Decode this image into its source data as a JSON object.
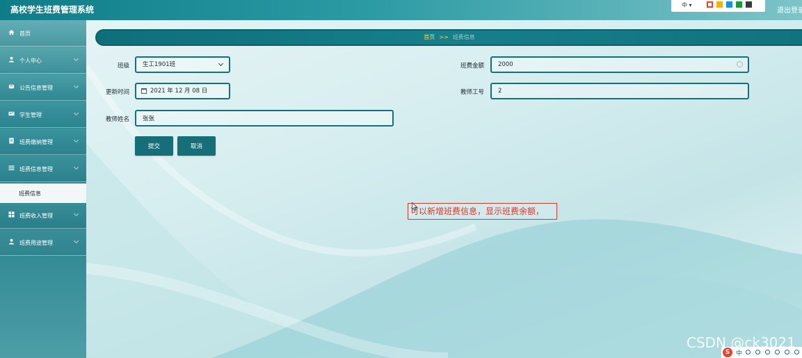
{
  "app": {
    "title": "高校学生班费管理系统",
    "logout_label": "退出登录"
  },
  "toolbox": {
    "ime_select": "中 ▾",
    "swatches": [
      "#e8412c",
      "#f2b21a",
      "#1b8fe0",
      "#1a9b3a",
      "#3a3a3a"
    ]
  },
  "sidebar": {
    "items": [
      {
        "label": "首页",
        "icon": "home-icon"
      },
      {
        "label": "个人中心",
        "icon": "user-icon"
      },
      {
        "label": "公告信息管理",
        "icon": "notice-icon"
      },
      {
        "label": "学生管理",
        "icon": "student-icon"
      },
      {
        "label": "班费缴纳管理",
        "icon": "payment-icon"
      },
      {
        "label": "班费信息管理",
        "icon": "list-icon"
      },
      {
        "label": "班费收入管理",
        "icon": "grid-icon"
      },
      {
        "label": "班费用途管理",
        "icon": "user-icon"
      }
    ],
    "sub_item": {
      "label": "班费信息"
    }
  },
  "breadcrumb": {
    "home": "首页",
    "separator": ">>",
    "current": "班费信息"
  },
  "form": {
    "class": {
      "label": "班级",
      "value": "生工1901班"
    },
    "amount": {
      "label": "班费金额",
      "value": "2000"
    },
    "update_time": {
      "label": "更新时间",
      "value": "2021 年 12 月 08 日"
    },
    "teacher_id": {
      "label": "教师工号",
      "value": "2"
    },
    "teacher_name": {
      "label": "教师姓名",
      "value": "张张"
    },
    "submit_label": "提交",
    "cancel_label": "取消"
  },
  "annotation": {
    "text": "可以新增班费信息，显示班费余额，"
  },
  "watermark": "CSDN @ck3021",
  "ime_bar": {
    "logo": "S",
    "lang": "中"
  },
  "colors": {
    "accent": "#166e79",
    "breadcrumb_home": "#ffd34a",
    "annotation": "#d43b2a"
  }
}
